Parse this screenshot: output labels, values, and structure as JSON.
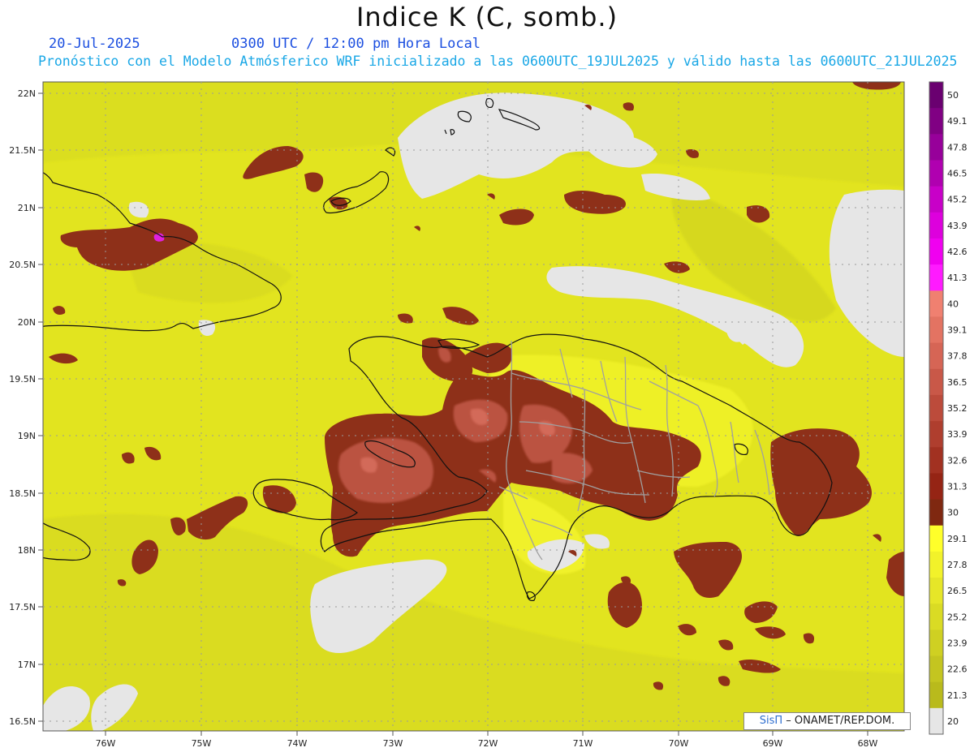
{
  "header": {
    "title": "Indice K (C, somb.)",
    "date": "20-Jul-2025",
    "time_label": "0300 UTC / 12:00 pm Hora Local",
    "subtitle": "Pronóstico con el Modelo Atmósferico WRF inicializado a las 0600UTC_19JUL2025 y válido hasta las  0600UTC_21JUL2025"
  },
  "map": {
    "lat_labels": [
      "22N",
      "21.5N",
      "21N",
      "20.5N",
      "20N",
      "19.5N",
      "19N",
      "18.5N",
      "18N",
      "17.5N",
      "17N",
      "16.5N"
    ],
    "lon_labels": [
      "76W",
      "75W",
      "74W",
      "73W",
      "72W",
      "71W",
      "70W",
      "69W",
      "68W"
    ]
  },
  "colorbar": {
    "labels": [
      "50",
      "49.1",
      "47.8",
      "46.5",
      "45.2",
      "43.9",
      "42.6",
      "41.3",
      "40",
      "39.1",
      "37.8",
      "36.5",
      "35.2",
      "33.9",
      "32.6",
      "31.3",
      "30",
      "29.1",
      "27.8",
      "26.5",
      "25.2",
      "23.9",
      "22.6",
      "21.3",
      "20"
    ],
    "colors": [
      "#6a0070",
      "#800083",
      "#97009a",
      "#b000b0",
      "#c800c8",
      "#dd00dd",
      "#f000f0",
      "#ff1aff",
      "#f08070",
      "#e37362",
      "#d66555",
      "#c95848",
      "#bc4b3b",
      "#af3e2e",
      "#a23121",
      "#952414",
      "#7f2810",
      "#ffff2a",
      "#f2f22a",
      "#e6e628",
      "#dadb24",
      "#cfd022",
      "#c4c520",
      "#b9ba1c",
      "#e6e6e6"
    ]
  },
  "credit": {
    "brand": "SisΠ",
    "text": " – ONAMET/REP.DOM."
  }
}
